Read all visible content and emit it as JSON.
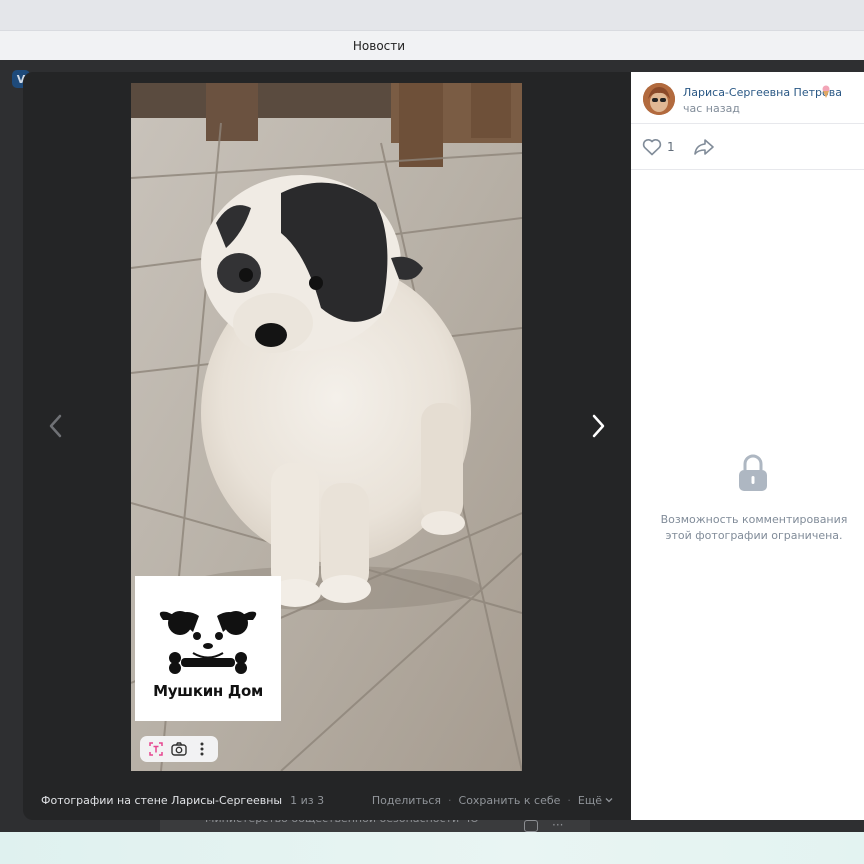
{
  "browser": {
    "page_title": "Новости"
  },
  "background": {
    "logo_letter": "V",
    "feed_snippet": "Министерство общественной безопасности ЧО",
    "more_dots": "···"
  },
  "viewer": {
    "album_title": "Фотографии на стене Ларисы-Сергеевны",
    "counter": "1 из 3",
    "actions": {
      "share": "Поделиться",
      "save": "Сохранить к себе",
      "more": "Ещё"
    },
    "separator": "·",
    "watermark_text": "Мушкин Дом",
    "prev_icon": "chevron-left-icon",
    "next_icon": "chevron-right-icon",
    "tools": [
      "text-recognition-icon",
      "camera-icon",
      "more-vertical-icon"
    ]
  },
  "post": {
    "author_name": "Лариса-Сергеевна Петрова",
    "time": "час назад",
    "likes": "1",
    "comments_restricted": "Возможность комментирования этой фотографии ограничена."
  },
  "colors": {
    "accent_link": "#2a5885",
    "muted_text": "#818c99",
    "viewer_bg": "#242526",
    "tool_highlight": "#e64690"
  }
}
